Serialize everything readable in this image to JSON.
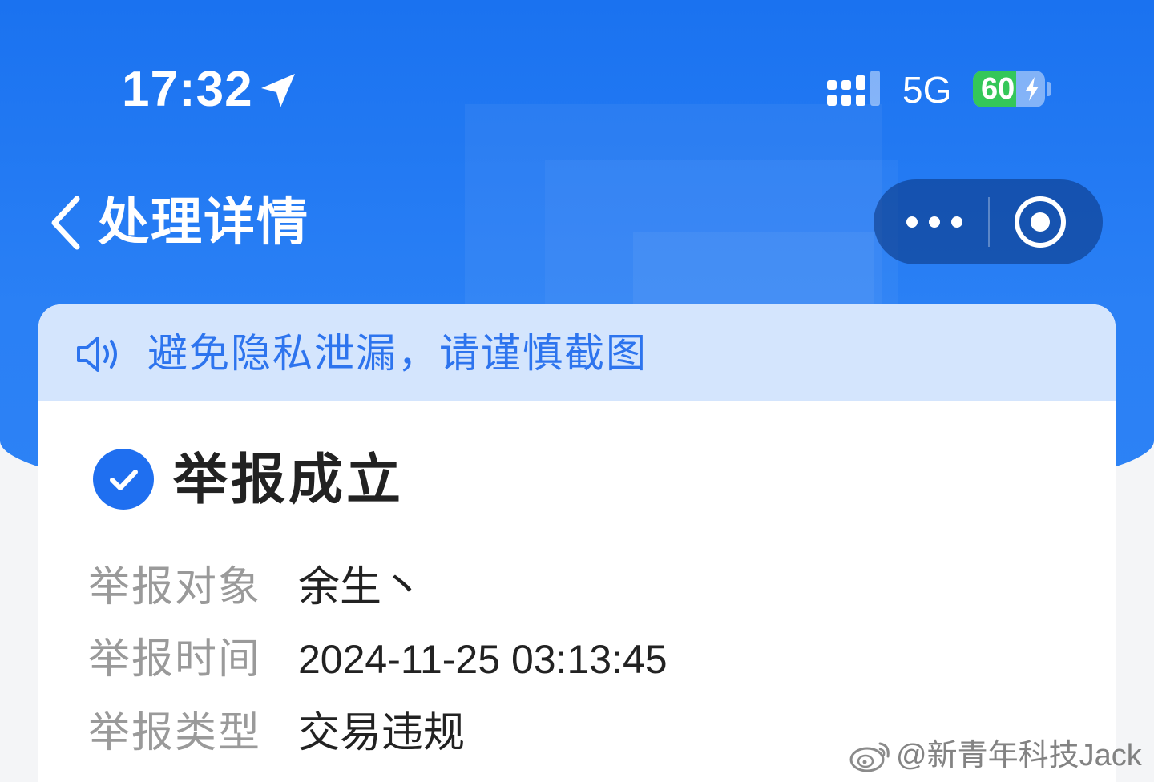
{
  "status_bar": {
    "time": "17:32",
    "network": "5G",
    "battery_level": 60,
    "battery_text": "60"
  },
  "nav": {
    "title": "处理详情"
  },
  "notice": {
    "text": "避免隐私泄漏，请谨慎截图"
  },
  "result": {
    "status": "举报成立"
  },
  "details": [
    {
      "label": "举报对象",
      "value": "余生丶"
    },
    {
      "label": "举报时间",
      "value": "2024-11-25 03:13:45"
    },
    {
      "label": "举报类型",
      "value": "交易违规"
    }
  ],
  "watermark": {
    "text": "@新青年科技Jack"
  },
  "colors": {
    "primary_blue": "#2a80f5",
    "notice_bg": "#d4e5fd",
    "notice_text": "#2d74ee",
    "battery_green": "#34c759",
    "check_blue": "#1f6ff0"
  }
}
